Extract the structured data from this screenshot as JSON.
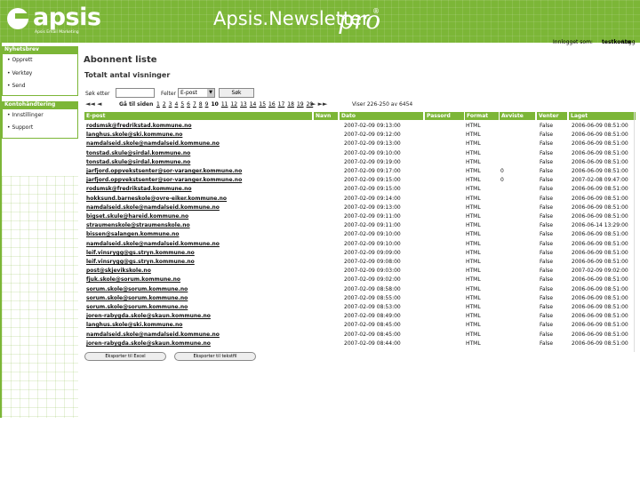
{
  "brand": {
    "logo_text": "apsis",
    "tagline": "Apsis Email Marketing",
    "product_title": "Apsis.Newsletter",
    "product_suffix": "pro",
    "product_mark": "®"
  },
  "login": {
    "text": "Innlogget som:",
    "user": "testkonto",
    "logout": "Logg"
  },
  "sidebar": {
    "section1": "Nyhetsbrev",
    "items1": [
      "Opprett",
      "Verktøy",
      "Send"
    ],
    "section2": "Kontohåndtering",
    "items2": [
      "Innstillinger",
      "Support"
    ]
  },
  "page": {
    "title": "Abonnent liste",
    "subtitle": "Totalt antal visninger"
  },
  "search": {
    "label": "Søk etter",
    "field_label": "Felter",
    "field_value": "E-post",
    "button": "Søk"
  },
  "pager": {
    "goto_label": "Gå til siden",
    "pages": [
      "1",
      "2",
      "3",
      "4",
      "5",
      "6",
      "7",
      "8",
      "9",
      "10",
      "11",
      "12",
      "13",
      "14",
      "15",
      "16",
      "17",
      "18",
      "19",
      "20"
    ],
    "current": "10",
    "result_info": "Viser 226-250 av 6454"
  },
  "table": {
    "columns": [
      "E-post",
      "Navn",
      "Dato",
      "Passord",
      "Format",
      "Avviste",
      "Venter",
      "Laget"
    ],
    "rows": [
      {
        "email": "rodsmsk@fredrikstad.kommune.no",
        "date": "2007-02-09 09:13:00",
        "format": "HTML",
        "bounced": "",
        "sent": "False",
        "created": "2006-06-09 08:51:00"
      },
      {
        "email": "langhus.skole@ski.kommune.no",
        "date": "2007-02-09 09:12:00",
        "format": "HTML",
        "bounced": "",
        "sent": "False",
        "created": "2006-06-09 08:51:00"
      },
      {
        "email": "namdalseid.skole@namdalseid.kommune.no",
        "date": "2007-02-09 09:13:00",
        "format": "HTML",
        "bounced": "",
        "sent": "False",
        "created": "2006-06-09 08:51:00"
      },
      {
        "email": "tonstad.skule@sirdal.kommune.no",
        "date": "2007-02-09 09:10:00",
        "format": "HTML",
        "bounced": "",
        "sent": "False",
        "created": "2006-06-09 08:51:00"
      },
      {
        "email": "tonstad.skule@sirdal.kommune.no",
        "date": "2007-02-09 09:19:00",
        "format": "HTML",
        "bounced": "",
        "sent": "False",
        "created": "2006-06-09 08:51:00"
      },
      {
        "email": "jarfjord.oppvekstsenter@sor-varanger.kommune.no",
        "date": "2007-02-09 09:17:00",
        "format": "HTML",
        "bounced": "0",
        "sent": "False",
        "created": "2006-06-09 08:51:00"
      },
      {
        "email": "jarfjord.oppvekstsenter@sor-varanger.kommune.no",
        "date": "2007-02-09 09:15:00",
        "format": "HTML",
        "bounced": "0",
        "sent": "False",
        "created": "2007-02-08 09:47:00"
      },
      {
        "email": "rodsmsk@fredrikstad.kommune.no",
        "date": "2007-02-09 09:15:00",
        "format": "HTML",
        "bounced": "",
        "sent": "False",
        "created": "2006-06-09 08:51:00"
      },
      {
        "email": "hokksund.barneskole@ovre-eiker.kommune.no",
        "date": "2007-02-09 09:14:00",
        "format": "HTML",
        "bounced": "",
        "sent": "False",
        "created": "2006-06-09 08:51:00"
      },
      {
        "email": "namdalseid.skole@namdalseid.kommune.no",
        "date": "2007-02-09 09:13:00",
        "format": "HTML",
        "bounced": "",
        "sent": "False",
        "created": "2006-06-09 08:51:00"
      },
      {
        "email": "bigset.skule@hareid.kommune.no",
        "date": "2007-02-09 09:11:00",
        "format": "HTML",
        "bounced": "",
        "sent": "False",
        "created": "2006-06-09 08:51:00"
      },
      {
        "email": "straumenskole@straumenskole.no",
        "date": "2007-02-09 09:11:00",
        "format": "HTML",
        "bounced": "",
        "sent": "False",
        "created": "2006-06-14 13:29:00"
      },
      {
        "email": "bissen@salangen.kommune.no",
        "date": "2007-02-09 09:10:00",
        "format": "HTML",
        "bounced": "",
        "sent": "False",
        "created": "2006-06-09 08:51:00"
      },
      {
        "email": "namdalseid.skole@namdalseid.kommune.no",
        "date": "2007-02-09 09:10:00",
        "format": "HTML",
        "bounced": "",
        "sent": "False",
        "created": "2006-06-09 08:51:00"
      },
      {
        "email": "leif.vinsrygg@gs.stryn.kommune.no",
        "date": "2007-02-09 09:09:00",
        "format": "HTML",
        "bounced": "",
        "sent": "False",
        "created": "2006-06-09 08:51:00"
      },
      {
        "email": "leif.vinsrygg@gs.stryn.kommune.no",
        "date": "2007-02-09 09:08:00",
        "format": "HTML",
        "bounced": "",
        "sent": "False",
        "created": "2006-06-09 08:51:00"
      },
      {
        "email": "post@skjevikskole.no",
        "date": "2007-02-09 09:03:00",
        "format": "HTML",
        "bounced": "",
        "sent": "False",
        "created": "2007-02-09 09:02:00"
      },
      {
        "email": "fjuk.skole@sorum.kommune.no",
        "date": "2007-02-09 09:02:00",
        "format": "HTML",
        "bounced": "",
        "sent": "False",
        "created": "2006-06-09 08:51:00"
      },
      {
        "email": "sorum.skole@sorum.kommune.no",
        "date": "2007-02-09 08:58:00",
        "format": "HTML",
        "bounced": "",
        "sent": "False",
        "created": "2006-06-09 08:51:00"
      },
      {
        "email": "sorum.skole@sorum.kommune.no",
        "date": "2007-02-09 08:55:00",
        "format": "HTML",
        "bounced": "",
        "sent": "False",
        "created": "2006-06-09 08:51:00"
      },
      {
        "email": "sorum.skole@sorum.kommune.no",
        "date": "2007-02-09 08:53:00",
        "format": "HTML",
        "bounced": "",
        "sent": "False",
        "created": "2006-06-09 08:51:00"
      },
      {
        "email": "joren-rabygda.skole@skaun.kommune.no",
        "date": "2007-02-09 08:49:00",
        "format": "HTML",
        "bounced": "",
        "sent": "False",
        "created": "2006-06-09 08:51:00"
      },
      {
        "email": "langhus.skole@ski.kommune.no",
        "date": "2007-02-09 08:45:00",
        "format": "HTML",
        "bounced": "",
        "sent": "False",
        "created": "2006-06-09 08:51:00"
      },
      {
        "email": "namdalseid.skole@namdalseid.kommune.no",
        "date": "2007-02-09 08:45:00",
        "format": "HTML",
        "bounced": "",
        "sent": "False",
        "created": "2006-06-09 08:51:00"
      },
      {
        "email": "joren-rabygda.skole@skaun.kommune.no",
        "date": "2007-02-09 08:44:00",
        "format": "HTML",
        "bounced": "",
        "sent": "False",
        "created": "2006-06-09 08:51:00"
      }
    ]
  },
  "export": {
    "excel": "Eksporter til Excel",
    "txt": "Eksporter til tekstfil"
  },
  "colors": {
    "brand_green": "#7cb637",
    "header_text": "#ffffff"
  }
}
